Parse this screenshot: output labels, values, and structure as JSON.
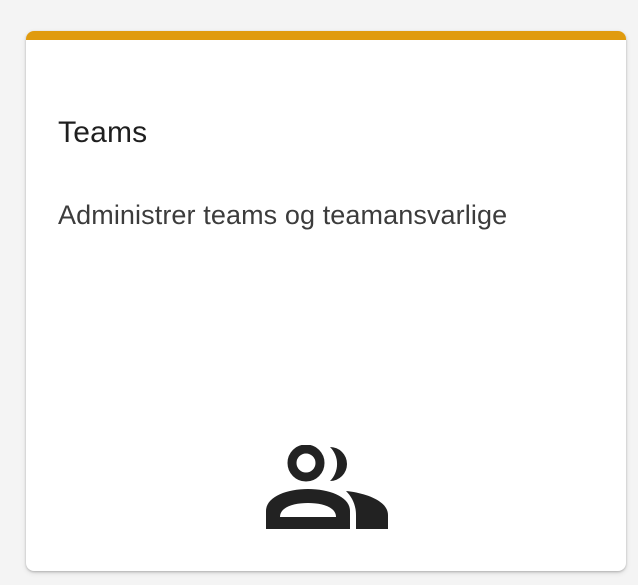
{
  "card": {
    "title": "Teams",
    "description": "Administrer teams og teamansvarlige",
    "icon": "people-icon",
    "accent_color": "#e09b0f"
  }
}
